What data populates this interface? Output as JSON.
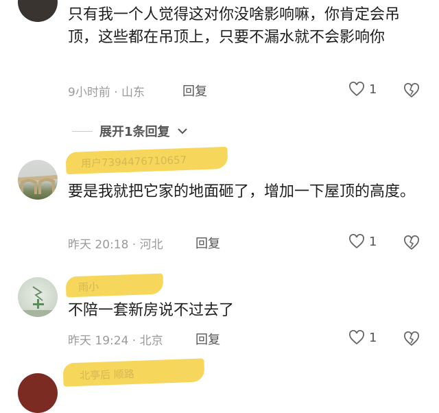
{
  "comments": [
    {
      "text": "只有我一个人觉得这对你没啥影响嘛，你肯定会吊顶，这些都在吊顶上，只要不漏水就不会影响你",
      "meta": "9小时前 · 山东",
      "reply_label": "回复",
      "likes": "1"
    },
    {
      "redacted_name": "用户7394476710657",
      "text": "要是我就把它家的地面砸了，增加一下屋顶的高度。",
      "meta": "昨天 20:18 · 河北",
      "reply_label": "回复",
      "likes": "1"
    },
    {
      "redacted_name": "雨小",
      "text": "不陪一套新房说不过去了",
      "meta": "昨天 19:24 · 北京",
      "reply_label": "回复",
      "likes": "1"
    },
    {
      "redacted_name": "北亭后 顺路"
    }
  ],
  "expand_replies": "展开1条回复",
  "colors": {
    "redaction": "#f7d454",
    "meta": "#9a9a9a"
  },
  "icons": {
    "like": "heart-outline-icon",
    "dislike": "broken-heart-icon",
    "expand": "chevron-down-icon"
  }
}
